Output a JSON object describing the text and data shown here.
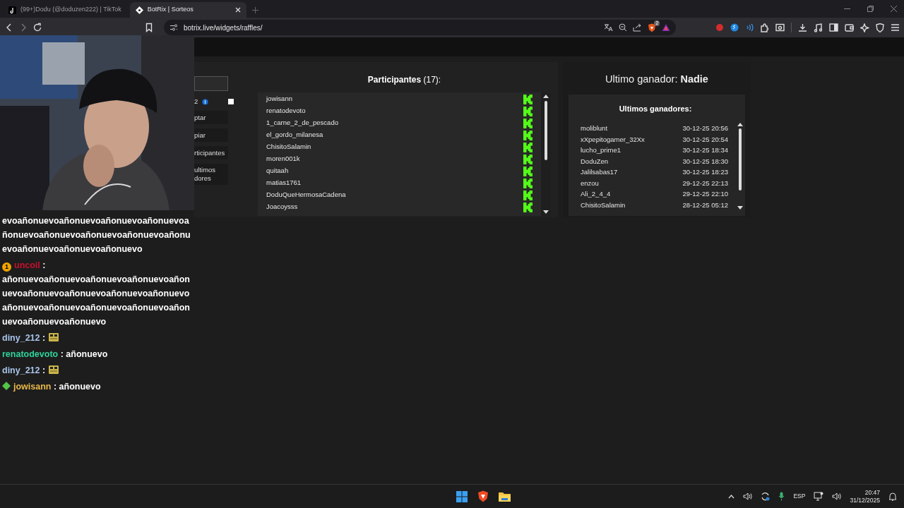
{
  "browser": {
    "tabs": [
      {
        "title": "(99+)Dodu (@doduzen222) | TikTok",
        "selected": false,
        "kind": "note"
      },
      {
        "title": "BotRix | Sorteos",
        "selected": true,
        "kind": "diamond"
      }
    ],
    "url": "botrix.live/widgets/raffles/",
    "shield_count": "2"
  },
  "controls": {
    "entry_count": "2",
    "option_checked": false,
    "buttons": [
      {
        "lines": [
          "ptar"
        ]
      },
      {
        "lines": [
          "piar"
        ]
      },
      {
        "lines": [
          "rticipantes"
        ]
      },
      {
        "lines": [
          "ultimos",
          "dores"
        ]
      }
    ]
  },
  "participants": {
    "title": "Participantes",
    "count": "(17):",
    "items": [
      "jowisann",
      "renatodevoto",
      "1_carne_2_de_pescado",
      "el_gordo_milanesa",
      "ChisitoSalamin",
      "moren001k",
      "quitaah",
      "matias1761",
      "DoduQueHermosaCadena",
      "Joacoysss"
    ]
  },
  "last_winner": {
    "label": "Ultimo ganador:",
    "name": "Nadie"
  },
  "winners": {
    "title": "Ultimos ganadores:",
    "rows": [
      {
        "name": "moliblunt",
        "time": "30-12-25 20:56"
      },
      {
        "name": "xXpepitogamer_32Xx",
        "time": "30-12-25 20:54"
      },
      {
        "name": "lucho_prime1",
        "time": "30-12-25 18:34"
      },
      {
        "name": "DoduZen",
        "time": "30-12-25 18:30"
      },
      {
        "name": "Jalilsabas17",
        "time": "30-12-25 18:23"
      },
      {
        "name": "enzou",
        "time": "29-12-25 22:13"
      },
      {
        "name": "Ali_2_4_4",
        "time": "29-12-25 22:10"
      },
      {
        "name": "ChisitoSalamin",
        "time": "28-12-25 05:12"
      }
    ]
  },
  "chat": [
    {
      "kind": "continuation",
      "text": "evoañonuevoañonuevoañonuevoañonuevoañonuevoañonuevoañonuevoañonuevoañonuevoañonuevoañonuevoañonuevo"
    },
    {
      "kind": "wrapped",
      "user": "uncoil",
      "colon": ":",
      "color": "#c8102e",
      "badge": {
        "kind": "number",
        "text": "1"
      },
      "text": "añonuevoañonuevoañonuevoañonuevoañonuevoañonuevoañonuevoañonuevoañonuevoañonuevoañonuevoañonuevoañonuevoañonuevoañonuevoañonuevo"
    },
    {
      "kind": "emote",
      "user": "diny_212",
      "colon": ":",
      "color": "#a8c4ea"
    },
    {
      "kind": "inline",
      "user": "renatodevoto",
      "colon": ":",
      "color": "#2fd39a",
      "text": "añonuevo"
    },
    {
      "kind": "emote",
      "user": "diny_212",
      "colon": ":",
      "color": "#a8c4ea"
    },
    {
      "kind": "inline",
      "user": "jowisann",
      "colon": ":",
      "color": "#e8b84a",
      "badge": {
        "kind": "diamond"
      },
      "text": "añonuevo"
    }
  ],
  "taskbar": {
    "language": "ESP",
    "time": "20:47",
    "date": "31/12/2025"
  }
}
